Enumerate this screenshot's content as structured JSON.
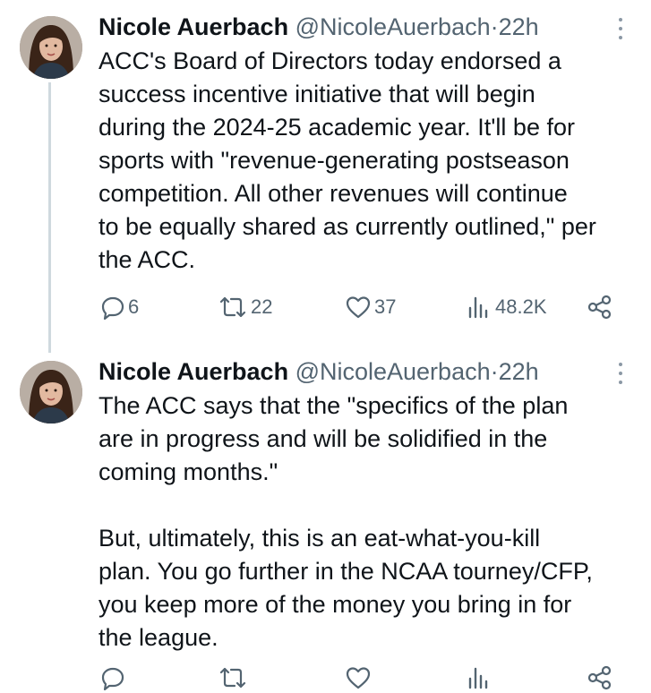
{
  "tweets": [
    {
      "author_name": "Nicole Auerbach",
      "handle": "@NicoleAuerbach",
      "separator": "·",
      "time": "22h",
      "text": "ACC's Board of Directors today endorsed a\nsuccess incentive initiative that will begin\nduring the 2024-25 academic year. It'll be for\nsports with \"revenue-generating postseason\ncompetition. All other revenues will continue\nto be equally shared as currently outlined,\" per\nthe ACC.",
      "replies": "6",
      "reposts": "22",
      "likes": "37",
      "views": "48.2K"
    },
    {
      "author_name": "Nicole Auerbach",
      "handle": "@NicoleAuerbach",
      "separator": "·",
      "time": "22h",
      "text": "The ACC says that the \"specifics of the plan\nare in progress and will be solidified in the\ncoming months.\"\n\nBut, ultimately, this is an eat-what-you-kill\nplan. You go further in the NCAA tourney/CFP,\nyou keep more of the money you bring in for\nthe league."
    }
  ],
  "icons": {
    "reply": "reply-icon",
    "retweet": "retweet-icon",
    "like": "heart-icon",
    "views": "views-icon",
    "share": "share-icon",
    "more": "more-icon"
  },
  "colors": {
    "text": "#0f1419",
    "secondary": "#536471",
    "thread_line": "#cfd9de"
  }
}
